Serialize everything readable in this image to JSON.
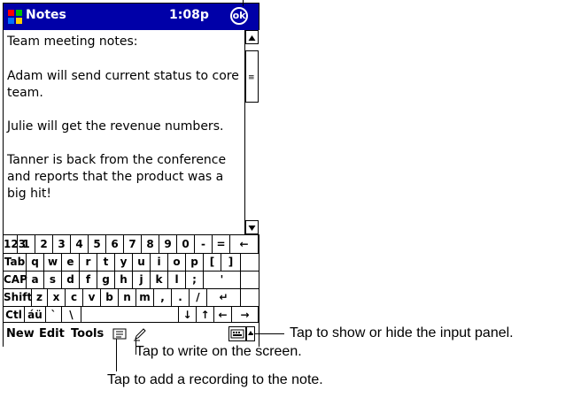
{
  "title_bar": {
    "app_name": "Notes",
    "time": "1:08p",
    "ok_label": "ok"
  },
  "note": {
    "lines": [
      "Team meeting notes:",
      "Adam will send current status to core team.",
      "Julie will get the revenue numbers.",
      "Tanner is back from the conference and reports that the product was a big hit!"
    ]
  },
  "keyboard": {
    "rows": [
      [
        "123",
        "1",
        "2",
        "3",
        "4",
        "5",
        "6",
        "7",
        "8",
        "9",
        "0",
        "-",
        "=",
        "←"
      ],
      [
        "Tab",
        "q",
        "w",
        "e",
        "r",
        "t",
        "y",
        "u",
        "i",
        "o",
        "p",
        "[",
        "]"
      ],
      [
        "CAP",
        "a",
        "s",
        "d",
        "f",
        "g",
        "h",
        "j",
        "k",
        "l",
        ";",
        "'"
      ],
      [
        "Shift",
        "z",
        "x",
        "c",
        "v",
        "b",
        "n",
        "m",
        ",",
        ".",
        "/",
        "↵"
      ],
      [
        "Ctl",
        "áü",
        "`",
        "\\",
        "",
        "↓",
        "↑",
        "←",
        "→"
      ]
    ]
  },
  "command_bar": {
    "menus": [
      "New",
      "Edit",
      "Tools"
    ]
  },
  "callouts": {
    "input_panel": "Tap to show or hide the input panel.",
    "write": "Tap to write on the screen.",
    "recording": "Tap to add a recording to the note."
  },
  "colors": {
    "title_bar_bg": "#0000a8"
  },
  "icons": [
    "windows-flag-icon",
    "ok-icon",
    "scroll-up-icon",
    "scroll-down-icon",
    "recording-icon",
    "pen-icon",
    "keyboard-icon",
    "input-panel-arrow-icon"
  ]
}
